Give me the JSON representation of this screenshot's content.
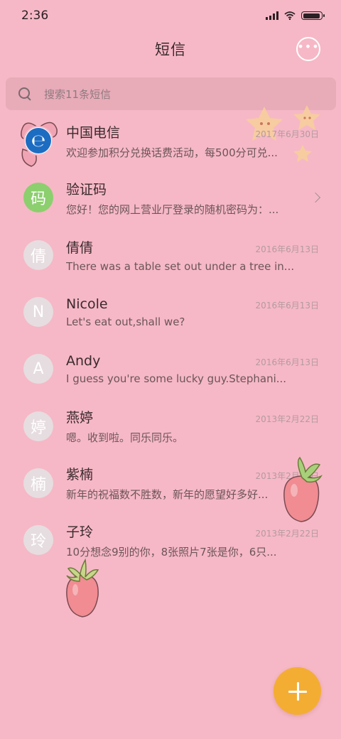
{
  "status_bar": {
    "time": "2:36",
    "battery_level": 0.95
  },
  "header": {
    "title": "短信",
    "more_icon": "more-dots-icon"
  },
  "search": {
    "placeholder": "搜索11条短信",
    "icon": "search-icon"
  },
  "conversations": [
    {
      "avatar": "",
      "avatar_type": "telecom-logo",
      "name": "中国电信",
      "date": "2017年6月30日",
      "preview": "欢迎参加积分兑换话费活动，每500分可兑..."
    },
    {
      "avatar": "码",
      "avatar_type": "green",
      "name": "验证码",
      "date": "",
      "preview": "您好！您的网上营业厅登录的随机密码为：...",
      "has_chevron": true
    },
    {
      "avatar": "倩",
      "avatar_type": "gray",
      "name": "倩倩",
      "date": "2016年6月13日",
      "preview": "There was a table set out under a tree in..."
    },
    {
      "avatar": "N",
      "avatar_type": "gray",
      "name": "Nicole",
      "date": "2016年6月13日",
      "preview": "Let's eat out,shall we?"
    },
    {
      "avatar": "A",
      "avatar_type": "gray",
      "name": "Andy",
      "date": "2016年6月13日",
      "preview": "I guess you're some lucky guy.Stephani..."
    },
    {
      "avatar": "婷",
      "avatar_type": "gray",
      "name": "燕婷",
      "date": "2013年2月22日",
      "preview": "嗯。收到啦。同乐同乐。"
    },
    {
      "avatar": "楠",
      "avatar_type": "gray",
      "name": "紫楠",
      "date": "2013年2月22日",
      "preview": "新年的祝福数不胜数，新年的愿望好多好..."
    },
    {
      "avatar": "玲",
      "avatar_type": "gray",
      "name": "子玲",
      "date": "2013年2月22日",
      "preview": "10分想念9别的你，8张照片7张是你，6只..."
    }
  ],
  "fab": {
    "icon": "plus-icon"
  },
  "colors": {
    "background": "#f6b8c6",
    "fab": "#f4ad33",
    "green_avatar": "#8ccf6e",
    "telecom_blue": "#1c6dc2"
  }
}
